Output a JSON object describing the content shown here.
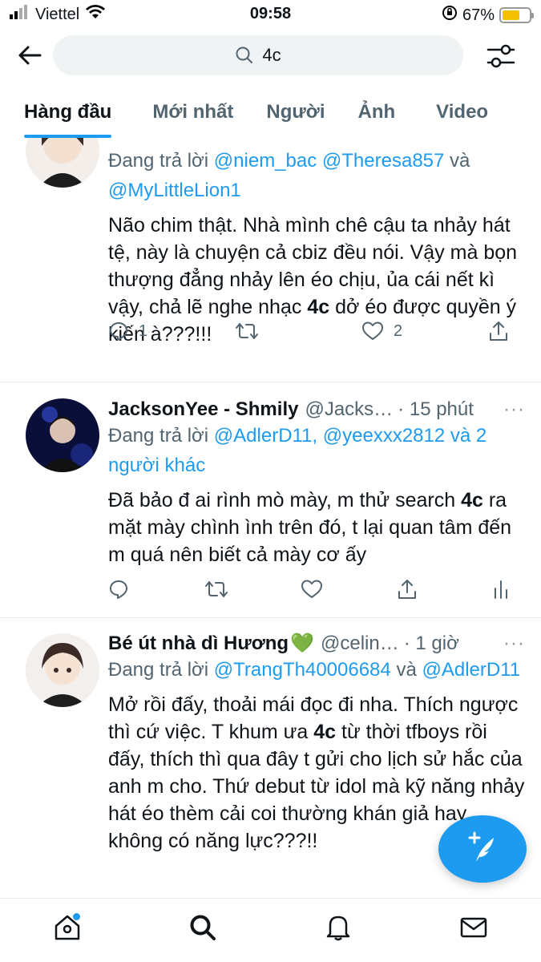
{
  "status_bar": {
    "carrier": "Viettel",
    "time": "09:58",
    "battery": "67%",
    "battery_level": 0.67
  },
  "search": {
    "query": "4c"
  },
  "tabs": [
    {
      "label": "Hàng đầu"
    },
    {
      "label": "Mới nhất"
    },
    {
      "label": "Người"
    },
    {
      "label": "Ảnh"
    },
    {
      "label": "Video"
    }
  ],
  "tweets": [
    {
      "reply_prefix": "Đang trả lời",
      "reply_mention_1": "@niem_bac",
      "reply_mention_2": "@Theresa857",
      "reply_and": "và",
      "reply_mention_3": "@MyLittleLion1",
      "text_before": "Não chim thật. Nhà mình chê cậu ta nhảy hát tệ, này là chuyện cả cbiz đều nói. Vậy mà bọn thượng đẳng nhảy lên éo chịu, ủa cái nết kì vậy, chả lẽ nghe nhạc ",
      "text_bold": "4c",
      "text_after": " dở éo được quyền ý kiến à???!!!",
      "reply_count": "1",
      "like_count": "2"
    },
    {
      "name": "JacksonYee - Shmily",
      "handle": "@Jacks…",
      "time": "· 15 phút",
      "more": "···",
      "reply_prefix": "Đang trả lời",
      "reply_mentions": "@AdlerD11, @yeexxx2812 và 2 người khác",
      "text_before": "Đã bảo đ ai rình mò mày, m thử search ",
      "text_bold": "4c",
      "text_after": " ra mặt mày chình ình trên đó, t lại quan tâm đến m quá nên biết cả mày cơ ấy"
    },
    {
      "name": "Bé út nhà dì Hương",
      "name_emoji": "💚",
      "handle": "@celin…",
      "time": "· 1 giờ",
      "more": "···",
      "reply_prefix": "Đang trả lời",
      "reply_mention_1": "@TrangTh40006684",
      "reply_and": "và",
      "reply_mention_2": "@AdlerD11",
      "text_before": "Mở rồi đấy, thoải mái đọc đi nha. Thích ngược thì cứ việc. T khum ưa ",
      "text_bold": "4c",
      "text_after": " từ thời tfboys rồi đấy, thích thì qua đây t gửi cho lịch sử hắc của anh m cho. Thứ debut từ idol mà kỹ năng nhảy hát éo thèm cải coi thường khán giả hay không có năng lực???!!"
    }
  ],
  "colors": {
    "accent": "#1d9bf0",
    "text": "#0f1419",
    "secondary": "#536471"
  }
}
